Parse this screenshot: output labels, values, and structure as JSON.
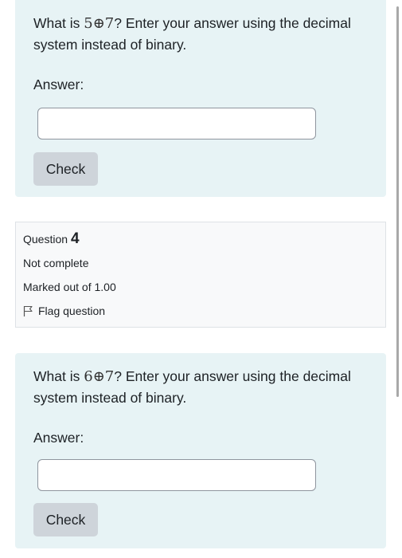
{
  "question3": {
    "text_before": "What is ",
    "math": "5⊕7",
    "text_after": "? Enter your answer using the decimal system instead of binary.",
    "answer_label": "Answer:",
    "answer_value": "",
    "check_label": "Check"
  },
  "question4_info": {
    "question_label": "Question",
    "question_number": "4",
    "state": "Not complete",
    "grade": "Marked out of 1.00",
    "flag_label": "Flag question"
  },
  "question4": {
    "text_before": "What is ",
    "math": "6⊕7",
    "text_after": "? Enter your answer using the decimal system instead of binary.",
    "answer_label": "Answer:",
    "answer_value": "",
    "check_label": "Check"
  },
  "icons": {
    "flag": "flag-icon"
  },
  "colors": {
    "formulation_bg": "#e7f3f5",
    "info_bg": "#f8f9fa",
    "button_bg": "#ced4da"
  }
}
